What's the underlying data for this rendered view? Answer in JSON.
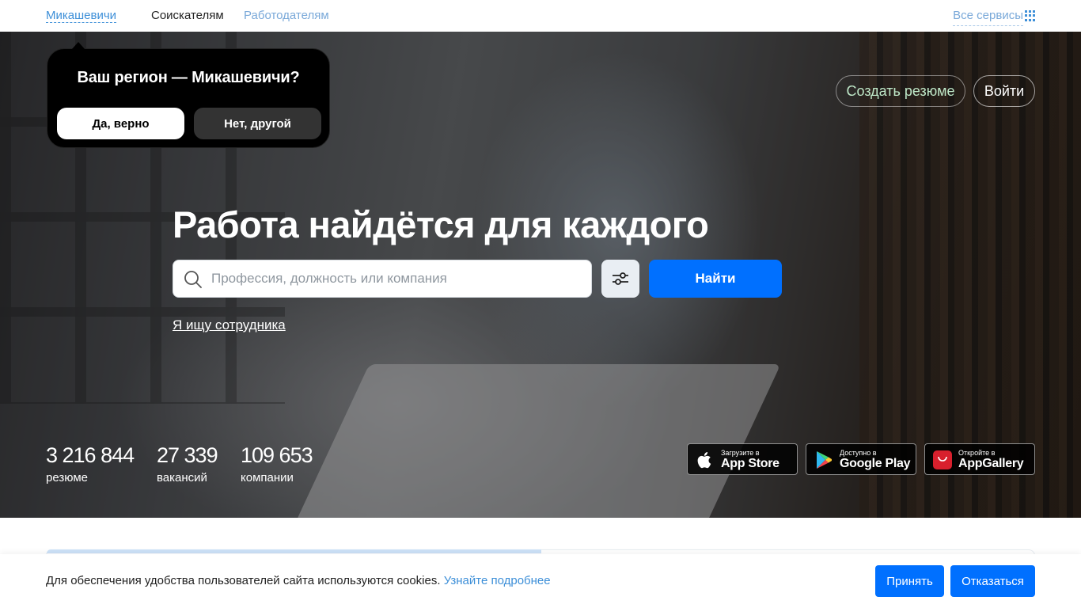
{
  "topnav": {
    "city": "Микашевичи",
    "seekers": "Соискателям",
    "employers": "Работодателям",
    "all_services": "Все сервисы"
  },
  "region_popup": {
    "question": "Ваш регион — Микашевичи?",
    "yes_label": "Да, верно",
    "no_label": "Нет, другой"
  },
  "auth": {
    "create_resume": "Создать резюме",
    "login": "Войти"
  },
  "hero": {
    "headline": "Работа найдётся для каждого",
    "search_placeholder": "Профессия, должность или компания",
    "find_label": "Найти",
    "hire_link": "Я ищу сотрудника"
  },
  "stats": [
    {
      "value": "3 216 844",
      "label": "резюме"
    },
    {
      "value": "27 339",
      "label": "вакансий"
    },
    {
      "value": "109 653",
      "label": "компании"
    }
  ],
  "stores": [
    {
      "small": "Загрузите в",
      "big": "App Store",
      "icon": "apple-icon"
    },
    {
      "small": "Доступно в",
      "big": "Google Play",
      "icon": "google-play-icon"
    },
    {
      "small": "Откройте в",
      "big": "AppGallery",
      "icon": "huawei-icon"
    }
  ],
  "cookie": {
    "text": "Для обеспечения удобства пользователей сайта используются cookies.",
    "more": "Узнайте подробнее",
    "accept": "Принять",
    "decline": "Отказаться"
  },
  "colors": {
    "accent": "#0070ff",
    "link": "#3d8fd8",
    "popup_bg": "#000000"
  }
}
